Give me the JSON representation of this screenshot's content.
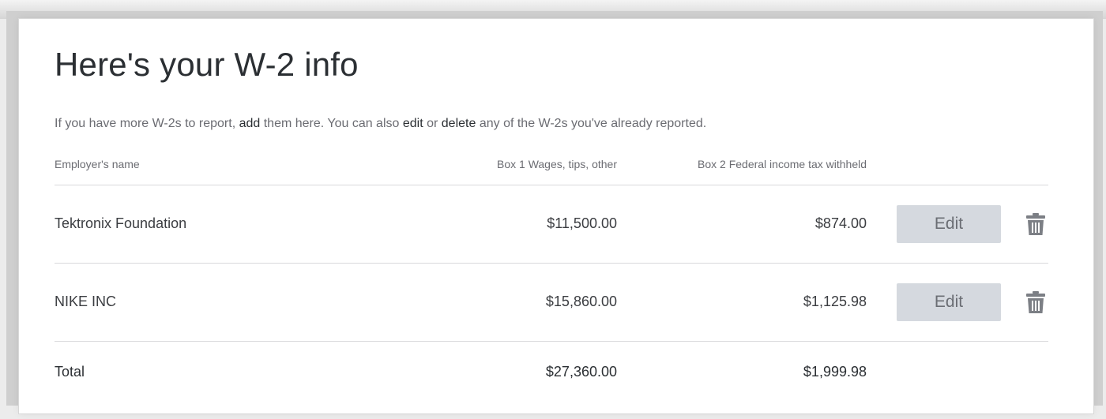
{
  "page": {
    "title": "Here's your W-2 info"
  },
  "intro": {
    "part1": "If you have more W-2s to report, ",
    "add_link": "add",
    "part2": " them here. You can also ",
    "edit_link": "edit",
    "part3": " or ",
    "delete_link": "delete",
    "part4": " any of the W-2s you've already reported."
  },
  "table": {
    "columns": {
      "employer": "Employer's name",
      "box1": "Box 1 Wages, tips, other",
      "box2": "Box 2 Federal income tax withheld"
    },
    "rows": [
      {
        "employer": "Tektronix Foundation",
        "box1": "$11,500.00",
        "box2": "$874.00",
        "edit_label": "Edit",
        "delete_icon": "trash-icon"
      },
      {
        "employer": "NIKE INC",
        "box1": "$15,860.00",
        "box2": "$1,125.98",
        "edit_label": "Edit",
        "delete_icon": "trash-icon"
      }
    ],
    "total": {
      "label": "Total",
      "box1": "$27,360.00",
      "box2": "$1,999.98"
    }
  },
  "colors": {
    "text_primary": "#2b2f33",
    "text_secondary": "#6b6c72",
    "button_bg": "#d5d9df",
    "icon": "#7c7f85"
  }
}
